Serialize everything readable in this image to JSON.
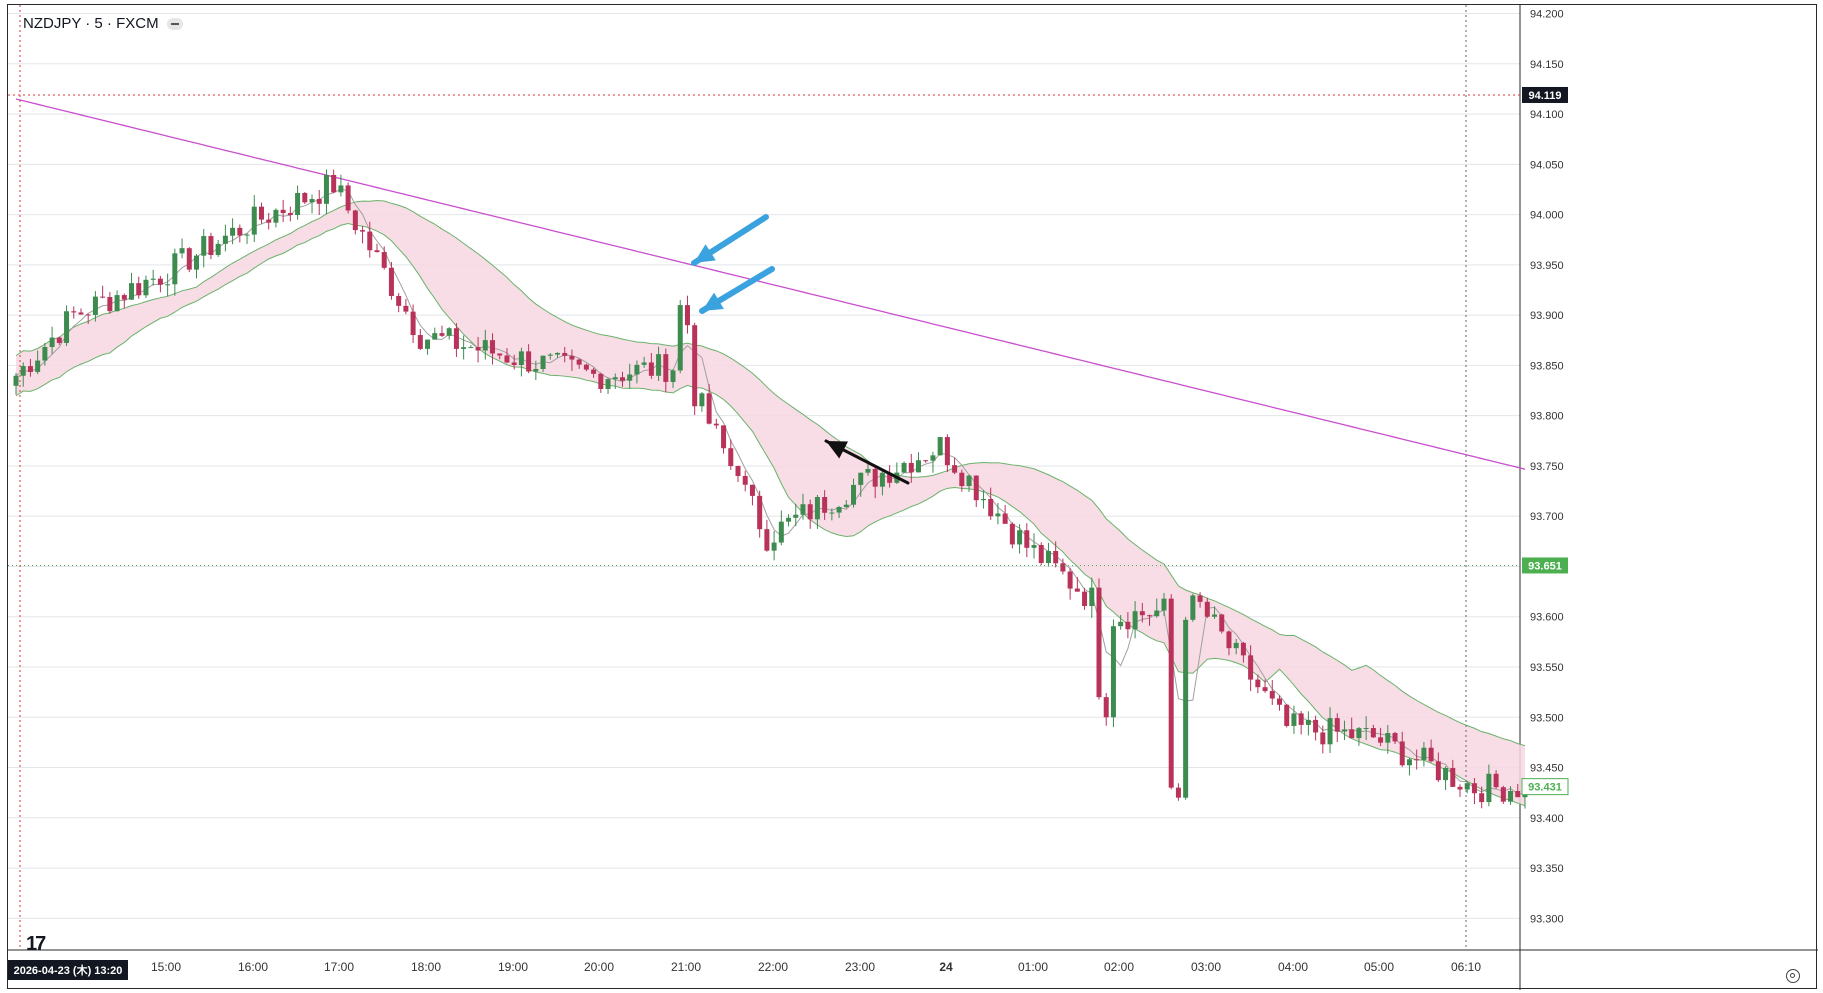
{
  "header": {
    "symbol_title": "NZDJPY · 5 · FXCM"
  },
  "colors": {
    "up_candle": "#3d8b4f",
    "down_candle": "#b8325a",
    "cloud_fill": "#f7d7e2",
    "cloud_line": "#6ab26a",
    "fast_ma": "#a0a0a0",
    "slow_ma": "#c94fcf",
    "crosshair": "#d9363e",
    "last_price_badge": "#4caf50",
    "cursor_badge": "#131722",
    "annotation_arrow_blue": "#3aa3df",
    "annotation_arrow_black": "#111111"
  },
  "price_badges": {
    "cursor_price": "94.119",
    "last_close_price": "93.651",
    "current_price": "93.431"
  },
  "time_badge": {
    "label": "2026-04-23 (木)  13:20"
  },
  "chart_data": {
    "type": "candlestick",
    "symbol": "NZDJPY",
    "timeframe": "5",
    "source": "FXCM",
    "y_axis": {
      "ticks": [
        "94.200",
        "94.150",
        "94.100",
        "94.050",
        "94.000",
        "93.950",
        "93.900",
        "93.850",
        "93.800",
        "93.750",
        "93.700",
        "93.650",
        "93.600",
        "93.550",
        "93.500",
        "93.450",
        "93.400",
        "93.350",
        "93.300"
      ],
      "ylim": [
        93.27,
        94.21
      ]
    },
    "x_axis": {
      "ticks": [
        "15:00",
        "16:00",
        "17:00",
        "18:00",
        "19:00",
        "20:00",
        "21:00",
        "22:00",
        "23:00",
        "24",
        "01:00",
        "02:00",
        "03:00",
        "04:00",
        "05:00",
        "06:10"
      ],
      "bold_ticks": [
        "24"
      ]
    },
    "grid": true,
    "horizontal_levels": [
      93.651
    ],
    "crosshair": {
      "price": 94.119,
      "time": "2026-04-23 13:20"
    },
    "approx_hourly_closes": [
      {
        "time": "13:20",
        "close": 93.84
      },
      {
        "time": "14:00",
        "close": 93.9
      },
      {
        "time": "15:00",
        "close": 93.94
      },
      {
        "time": "16:00",
        "close": 93.99
      },
      {
        "time": "17:00",
        "close": 94.03
      },
      {
        "time": "18:00",
        "close": 93.88
      },
      {
        "time": "19:00",
        "close": 93.86
      },
      {
        "time": "20:00",
        "close": 93.84
      },
      {
        "time": "21:00",
        "close": 93.85
      },
      {
        "time": "22:00",
        "close": 93.68
      },
      {
        "time": "23:00",
        "close": 93.73
      },
      {
        "time": "24",
        "close": 93.77
      },
      {
        "time": "01:00",
        "close": 93.67
      },
      {
        "time": "02:00",
        "close": 93.6
      },
      {
        "time": "03:00",
        "close": 93.61
      },
      {
        "time": "04:00",
        "close": 93.49
      },
      {
        "time": "05:00",
        "close": 93.48
      },
      {
        "time": "06:10",
        "close": 93.43
      }
    ],
    "price_range": {
      "high": 94.06,
      "low": 93.34
    }
  }
}
